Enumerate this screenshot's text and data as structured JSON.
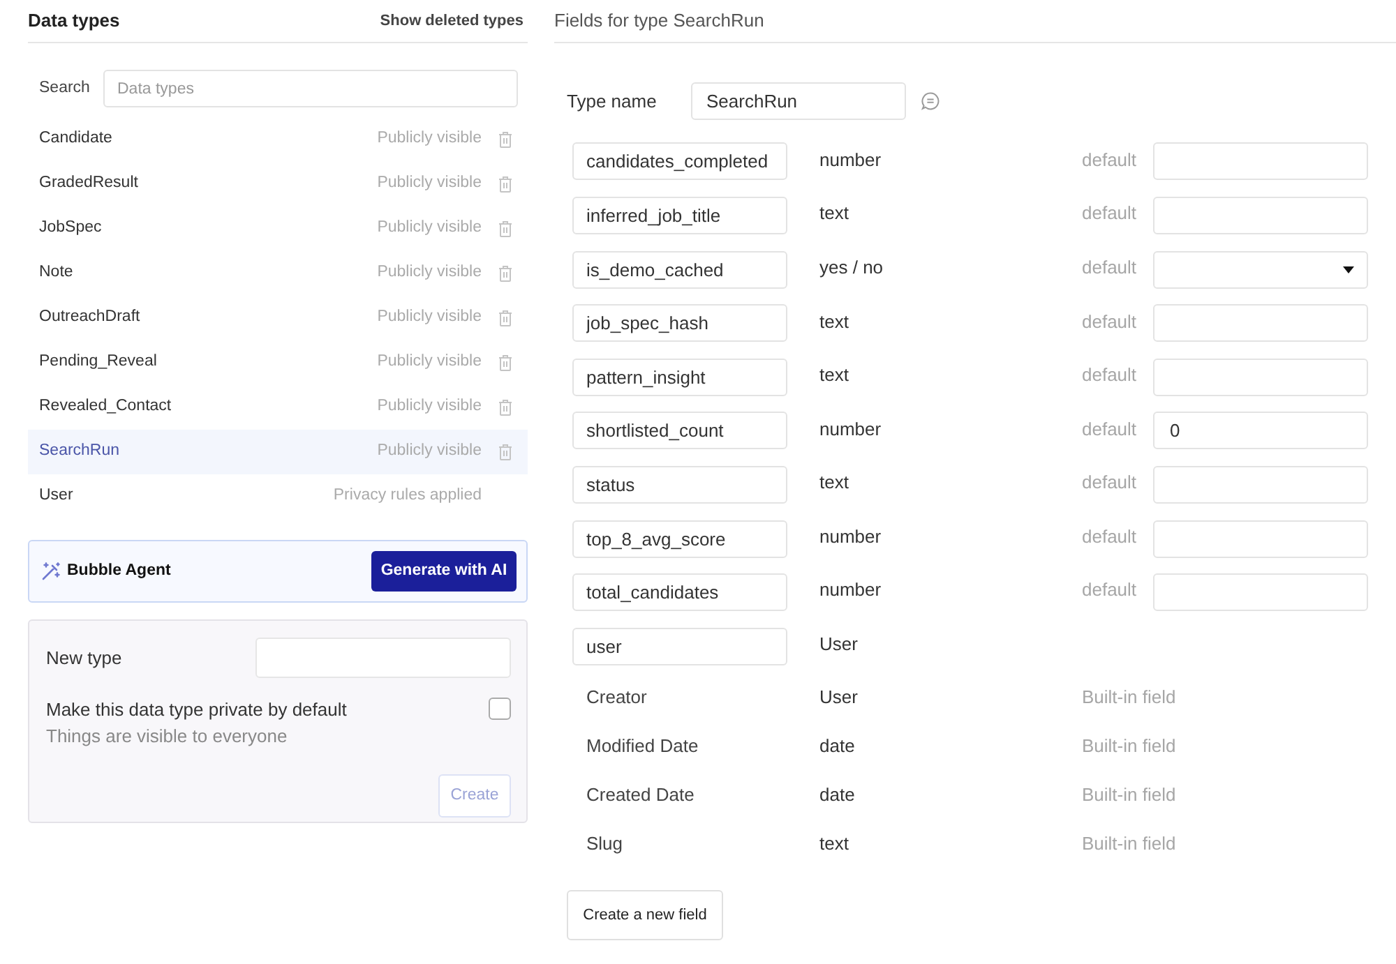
{
  "left_panel": {
    "title": "Data types",
    "show_deleted_link": "Show deleted types",
    "search": {
      "label": "Search",
      "placeholder": "Data types"
    },
    "types": [
      {
        "name": "Candidate",
        "visibility": "Publicly visible",
        "deletable": true,
        "selected": false
      },
      {
        "name": "GradedResult",
        "visibility": "Publicly visible",
        "deletable": true,
        "selected": false
      },
      {
        "name": "JobSpec",
        "visibility": "Publicly visible",
        "deletable": true,
        "selected": false
      },
      {
        "name": "Note",
        "visibility": "Publicly visible",
        "deletable": true,
        "selected": false
      },
      {
        "name": "OutreachDraft",
        "visibility": "Publicly visible",
        "deletable": true,
        "selected": false
      },
      {
        "name": "Pending_Reveal",
        "visibility": "Publicly visible",
        "deletable": true,
        "selected": false
      },
      {
        "name": "Revealed_Contact",
        "visibility": "Publicly visible",
        "deletable": true,
        "selected": false
      },
      {
        "name": "SearchRun",
        "visibility": "Publicly visible",
        "deletable": true,
        "selected": true
      },
      {
        "name": "User",
        "visibility": "Privacy rules applied",
        "deletable": false,
        "selected": false
      }
    ],
    "agent": {
      "label": "Bubble Agent",
      "button": "Generate with AI"
    },
    "new_type": {
      "label": "New type",
      "private_option": {
        "label": "Make this data type private by default",
        "hint": "Things are visible to everyone",
        "checked": false
      },
      "create_button": {
        "label": "Create",
        "disabled": true
      }
    }
  },
  "right_panel": {
    "title": "Fields for type SearchRun",
    "type_name": {
      "label": "Type name",
      "value": "SearchRun"
    },
    "fields": [
      {
        "kind": "custom",
        "name": "candidates_completed",
        "type": "number",
        "default": {
          "kind": "text",
          "label": "default"
        }
      },
      {
        "kind": "custom",
        "name": "inferred_job_title",
        "type": "text",
        "default": {
          "kind": "text",
          "label": "default"
        }
      },
      {
        "kind": "custom",
        "name": "is_demo_cached",
        "type": "yes / no",
        "default": {
          "kind": "dropdown",
          "label": "default"
        }
      },
      {
        "kind": "custom",
        "name": "job_spec_hash",
        "type": "text",
        "default": {
          "kind": "text",
          "label": "default"
        }
      },
      {
        "kind": "custom",
        "name": "pattern_insight",
        "type": "text",
        "default": {
          "kind": "text",
          "label": "default"
        }
      },
      {
        "kind": "custom",
        "name": "shortlisted_count",
        "type": "number",
        "default": {
          "kind": "text",
          "label": "default",
          "value": "0"
        }
      },
      {
        "kind": "custom",
        "name": "status",
        "type": "text",
        "default": {
          "kind": "text",
          "label": "default"
        }
      },
      {
        "kind": "custom",
        "name": "top_8_avg_score",
        "type": "number",
        "default": {
          "kind": "text",
          "label": "default"
        }
      },
      {
        "kind": "custom",
        "name": "total_candidates",
        "type": "number",
        "default": {
          "kind": "text",
          "label": "default"
        }
      },
      {
        "kind": "custom",
        "name": "user",
        "type": "User"
      },
      {
        "kind": "builtin",
        "name": "Creator",
        "type": "User",
        "note": "Built-in field"
      },
      {
        "kind": "builtin",
        "name": "Modified Date",
        "type": "date",
        "note": "Built-in field"
      },
      {
        "kind": "builtin",
        "name": "Created Date",
        "type": "date",
        "note": "Built-in field"
      },
      {
        "kind": "builtin",
        "name": "Slug",
        "type": "text",
        "note": "Built-in field"
      }
    ],
    "new_field_button": "Create a new field"
  }
}
